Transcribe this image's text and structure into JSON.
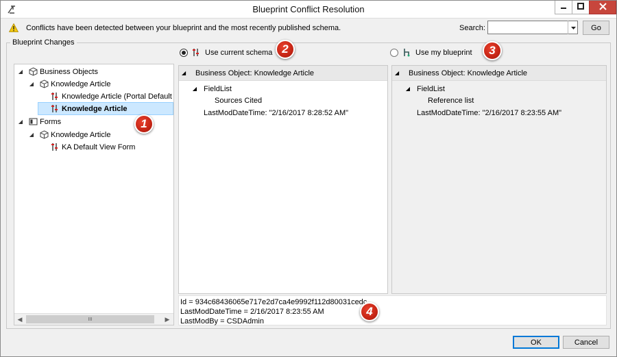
{
  "window": {
    "title": "Blueprint Conflict Resolution",
    "icons": {
      "app": "tool-icon",
      "minimize": "minimize-icon",
      "maximize": "maximize-icon",
      "close": "close-icon"
    }
  },
  "info_bar": {
    "message": "Conflicts have been detected between your blueprint and the most recently published schema.",
    "icon": "warning-icon"
  },
  "search": {
    "label": "Search:",
    "value": "",
    "button_label": "Go"
  },
  "group": {
    "title": "Blueprint Changes"
  },
  "tree": {
    "items": [
      {
        "label": "Business Objects",
        "level": 0,
        "icon": "cube-icon",
        "expanded": true
      },
      {
        "label": "Knowledge Article",
        "level": 1,
        "icon": "cube-icon",
        "expanded": true
      },
      {
        "label": "Knowledge Article (Portal Default …",
        "level": 2,
        "icon": "fields-icon"
      },
      {
        "label": "Knowledge Article",
        "level": 2,
        "icon": "fields-icon",
        "selected": true
      },
      {
        "label": "Forms",
        "level": 0,
        "icon": "form-icon",
        "expanded": true
      },
      {
        "label": "Knowledge Article",
        "level": 1,
        "icon": "cube-icon",
        "expanded": true
      },
      {
        "label": "KA Default View Form",
        "level": 2,
        "icon": "fields-icon"
      }
    ],
    "scrollbar_grip": "III"
  },
  "options": {
    "current_schema": {
      "label": "Use current schema",
      "selected": true
    },
    "my_blueprint": {
      "label": "Use my blueprint",
      "selected": false
    }
  },
  "left_pane": {
    "header": "Business Object: Knowledge Article",
    "field_list_label": "FieldList",
    "field_item": "Sources Cited",
    "last_mod": "LastModDateTime: \"2/16/2017 8:28:52 AM\""
  },
  "right_pane": {
    "header": "Business Object: Knowledge Article",
    "field_list_label": "FieldList",
    "field_item": "Reference list",
    "last_mod": "LastModDateTime: \"2/16/2017 8:23:55 AM\""
  },
  "details": {
    "lines": [
      "Id = 934c68436065e717e2d7ca4e9992f112d80031cedc",
      "LastModDateTime = 2/16/2017 8:23:55 AM",
      "LastModBy = CSDAdmin"
    ]
  },
  "markers": [
    "1",
    "2",
    "3",
    "4"
  ],
  "buttons": {
    "ok": "OK",
    "cancel": "Cancel"
  },
  "colors": {
    "marker_red": "#c62515",
    "selection": "#cce8ff",
    "close_red": "#c7463c"
  }
}
